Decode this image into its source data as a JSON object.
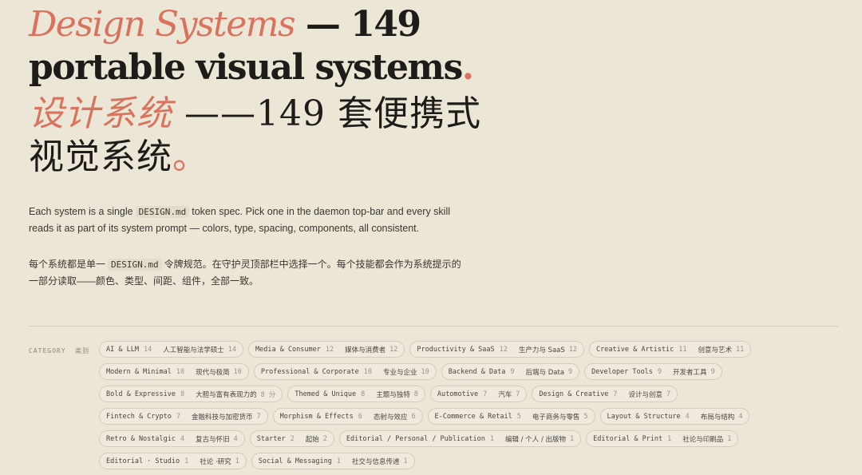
{
  "hero": {
    "en_accent": "Design Systems",
    "en_rest": " — 149",
    "en_line2": "portable visual systems",
    "en_dot": ".",
    "zh_accent": "设计系统",
    "zh_rest": " ——149 套便携式",
    "zh_line2": "视觉系统",
    "zh_dot": "。"
  },
  "description": {
    "en_before": "Each system is a single",
    "code": "DESIGN.md",
    "en_after": "token spec. Pick one in the daemon top-bar and every skill reads it as part of its system prompt — colors, type, spacing, components, all consistent.",
    "zh_before": "每个系统都是单一",
    "zh_code": "DESIGN.md",
    "zh_after": "令牌规范。在守护灵顶部栏中选择一个。每个技能都会作为系统提示的一部分读取——颜色、类型、间距、组件，全部一致。"
  },
  "category": {
    "label_en": "CATEGORY",
    "label_zh": "类别"
  },
  "categories": [
    {
      "name": "AI & LLM",
      "count": "14",
      "zh": "人工智能与法学硕士",
      "zcount": "14"
    },
    {
      "name": "Media & Consumer",
      "count": "12",
      "zh": "媒体与消费者",
      "zcount": "12"
    },
    {
      "name": "Productivity & SaaS",
      "count": "12",
      "zh": "生产力与 SaaS",
      "zcount": "12"
    },
    {
      "name": "Creative & Artistic",
      "count": "11",
      "zh": "创意与艺术",
      "zcount": "11"
    },
    {
      "name": "Modern & Minimal",
      "count": "10",
      "zh": "现代与极简",
      "zcount": "10"
    },
    {
      "name": "Professional & Corporate",
      "count": "10",
      "zh": "专业与企业",
      "zcount": "10"
    },
    {
      "name": "Backend & Data",
      "count": "9",
      "zh": "后端与 Data",
      "zcount": "9"
    },
    {
      "name": "Developer Tools",
      "count": "9",
      "zh": "开发者工具",
      "zcount": "9"
    },
    {
      "name": "Bold & Expressive",
      "count": "8",
      "zh": "大胆与富有表现力的",
      "zcount": "8 分"
    },
    {
      "name": "Themed & Unique",
      "count": "8",
      "zh": "主题与独特",
      "zcount": "8"
    },
    {
      "name": "Automotive",
      "count": "7",
      "zh": "汽车",
      "zcount": "7"
    },
    {
      "name": "Design & Creative",
      "count": "7",
      "zh": "设计与创意",
      "zcount": "7"
    },
    {
      "name": "Fintech & Crypto",
      "count": "7",
      "zh": "金融科技与加密货币",
      "zcount": "7"
    },
    {
      "name": "Morphism & Effects",
      "count": "6",
      "zh": "态射与效应",
      "zcount": "6"
    },
    {
      "name": "E-Commerce & Retail",
      "count": "5",
      "zh": "电子商务与零售",
      "zcount": "5"
    },
    {
      "name": "Layout & Structure",
      "count": "4",
      "zh": "布局与结构",
      "zcount": "4"
    },
    {
      "name": "Retro & Nostalgic",
      "count": "4",
      "zh": "复古与怀旧",
      "zcount": "4"
    },
    {
      "name": "Starter",
      "count": "2",
      "zh": "起始",
      "zcount": "2"
    },
    {
      "name": "Editorial / Personal / Publication",
      "count": "1",
      "zh": "编辑 / 个人 / 出版物",
      "zcount": "1"
    },
    {
      "name": "Editorial & Print",
      "count": "1",
      "zh": "社论与印刷品",
      "zcount": "1"
    },
    {
      "name": "Editorial · Studio",
      "count": "1",
      "zh": "社论 ·研究",
      "zcount": "1"
    },
    {
      "name": "Social & Messaging",
      "count": "1",
      "zh": "社交与信息传递",
      "zcount": "1"
    }
  ],
  "colors": {
    "accent": "#d9735e",
    "background": "#ece6d6"
  }
}
